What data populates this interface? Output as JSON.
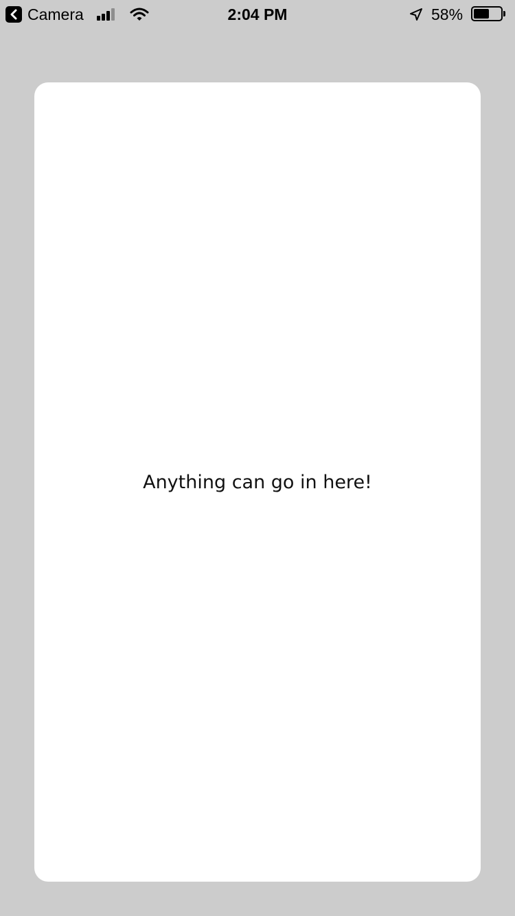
{
  "status_bar": {
    "back_app_label": "Camera",
    "back_icon": "chevron-left-icon",
    "signal_bars_active": 3,
    "signal_bars_total": 4,
    "wifi_icon": "wifi-icon",
    "time": "2:04 PM",
    "location_icon": "location-arrow-icon",
    "battery_percent_label": "58%",
    "battery_level": 0.58
  },
  "card": {
    "text": "Anything can go in here!"
  },
  "colors": {
    "background": "#cccccc",
    "card": "#ffffff"
  }
}
